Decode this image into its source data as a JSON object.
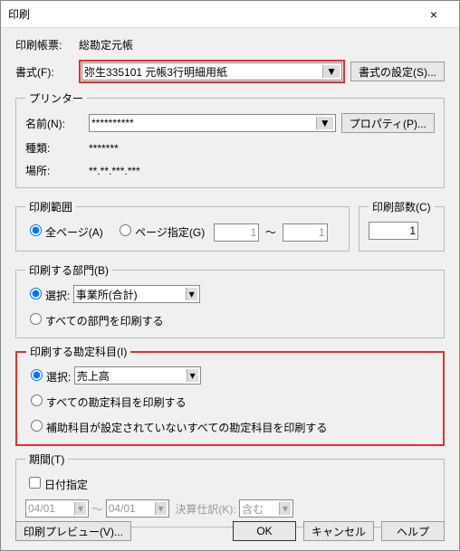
{
  "window": {
    "title": "印刷"
  },
  "header": {
    "report_label": "印刷帳票:",
    "report_value": "総勘定元帳",
    "format_label": "書式(F):",
    "format_value": "弥生335101 元帳3行明細用紙",
    "format_settings_btn": "書式の設定(S)..."
  },
  "printer": {
    "legend": "プリンター",
    "name_label": "名前(N):",
    "name_value": "**********",
    "properties_btn": "プロパティ(P)...",
    "type_label": "種類:",
    "type_value": "*******",
    "location_label": "場所:",
    "location_value": "**.**.***.***"
  },
  "range": {
    "legend": "印刷範囲",
    "all": "全ページ(A)",
    "pages": "ページ指定(G)",
    "from": "1",
    "tilde": "～",
    "to": "1"
  },
  "copies": {
    "legend": "印刷部数(C)",
    "value": "1"
  },
  "dept": {
    "legend": "印刷する部門(B)",
    "select_label": "選択:",
    "select_value": "事業所(合計)",
    "all_label": "すべての部門を印刷する"
  },
  "account": {
    "legend": "印刷する勘定科目(I)",
    "select_label": "選択:",
    "select_value": "売上高",
    "all_label": "すべての勘定科目を印刷する",
    "noaux_label": "補助科目が設定されていないすべての勘定科目を印刷する"
  },
  "period": {
    "legend": "期間(T)",
    "date_check": "日付指定",
    "from": "04/01",
    "tilde": "～",
    "to": "04/01",
    "adjust_label": "決算仕訳(K):",
    "adjust_value": "含む"
  },
  "footer": {
    "preview": "印刷プレビュー(V)...",
    "ok": "OK",
    "cancel": "キャンセル",
    "help": "ヘルプ"
  }
}
